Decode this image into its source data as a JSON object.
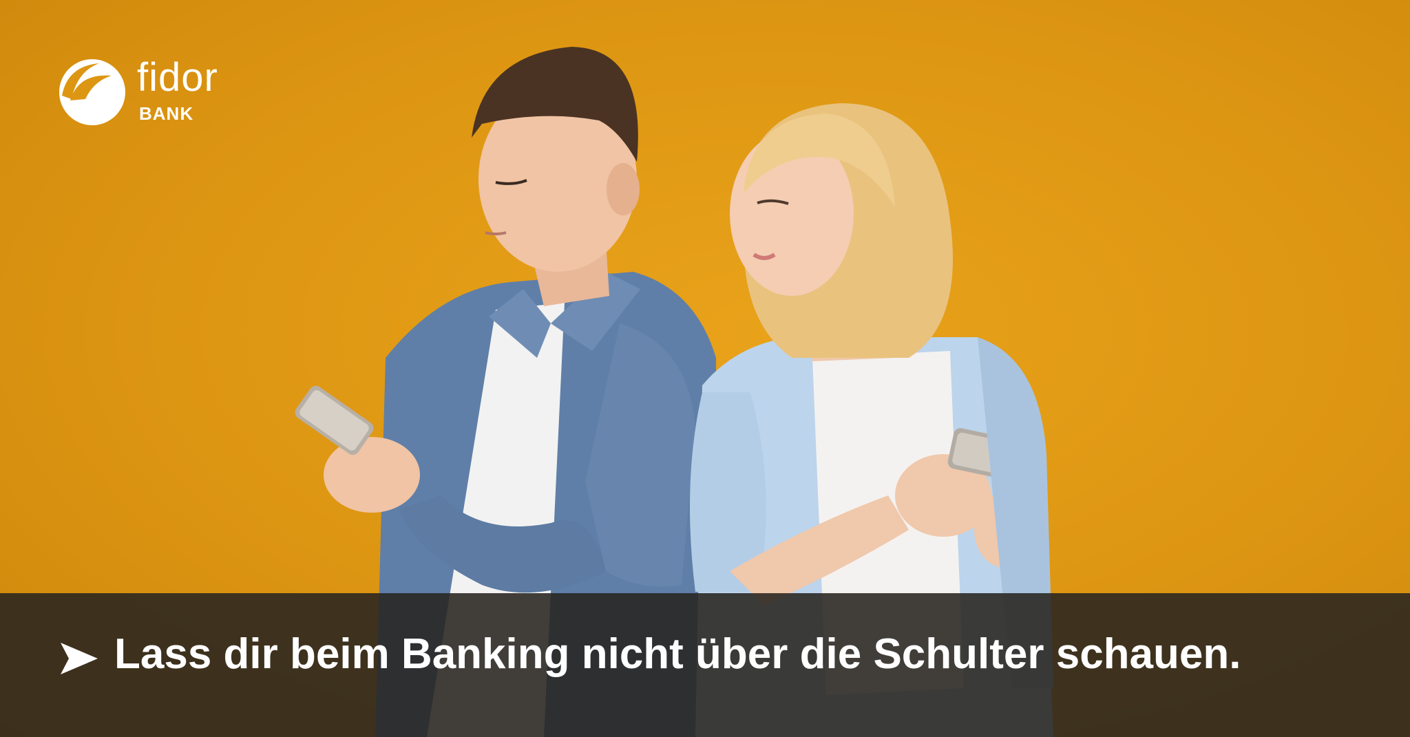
{
  "brand": {
    "name": "fidor",
    "sub": "BANK",
    "logo_icon": "fidor-swoosh-icon"
  },
  "banner": {
    "arrow_icon": "arrowhead-right-icon",
    "text": "Lass dir beim Banking nicht über die Schulter schauen."
  },
  "colors": {
    "background": "#dd9612",
    "banner": "#282420",
    "text": "#ffffff"
  }
}
